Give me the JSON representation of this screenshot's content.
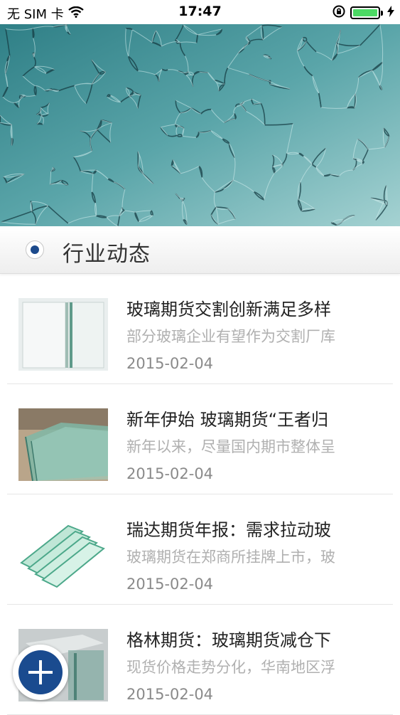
{
  "status_bar": {
    "carrier": "无 SIM 卡",
    "time": "17:47",
    "battery_level": 1.0,
    "icons": [
      "wifi-icon",
      "rotation-lock-icon",
      "battery-icon",
      "charging-icon"
    ]
  },
  "hero": {
    "image": "cracked-glass"
  },
  "section": {
    "title": "行业动态"
  },
  "news": [
    {
      "title": "玻璃期货交割创新满足多样",
      "summary": "部分玻璃企业有望作为交割厂库",
      "date": "2015-02-04",
      "thumb": "glass-panels-vertical"
    },
    {
      "title": "新年伊始 玻璃期货“王者归",
      "summary": "新年以来，尽量国内期市整体呈",
      "date": "2015-02-04",
      "thumb": "glass-sheets-warehouse"
    },
    {
      "title": "瑞达期货年报：需求拉动玻",
      "summary": "玻璃期货在郑商所挂牌上市，玻",
      "date": "2015-02-04",
      "thumb": "glass-stack"
    },
    {
      "title": "格林期货：玻璃期货减仓下",
      "summary": "现货价格走势分化，华南地区浮",
      "date": "2015-02-04",
      "thumb": "glass-panes-grey"
    }
  ],
  "fab": {
    "icon": "plus-icon"
  },
  "colors": {
    "accent": "#1a4b8f",
    "battery": "#4cd964",
    "summary_text": "#b0b0b0"
  }
}
